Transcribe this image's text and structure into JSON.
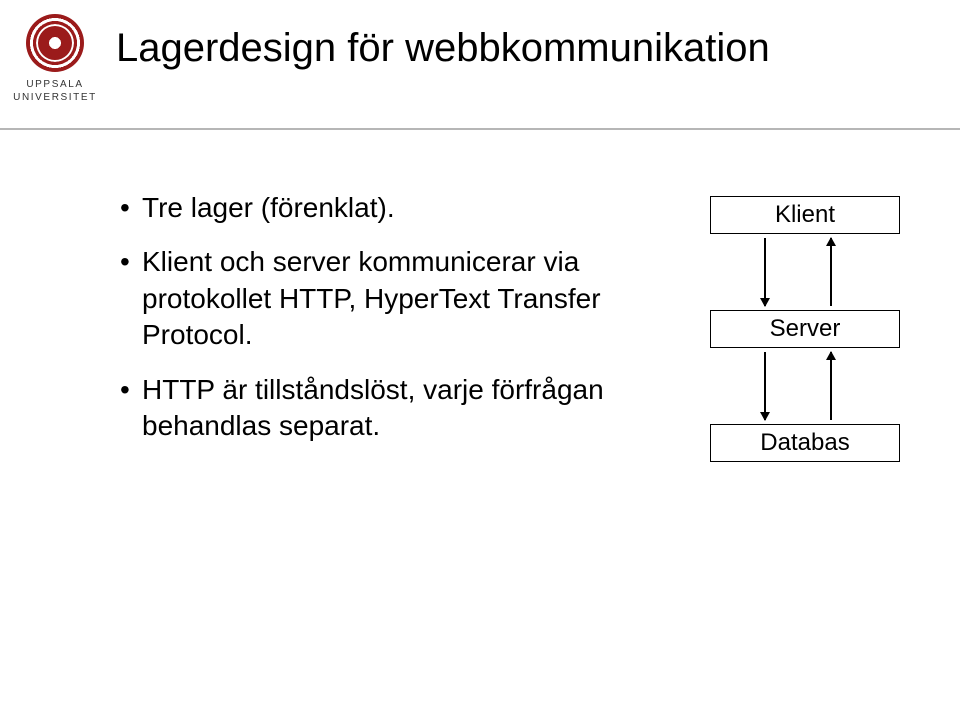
{
  "header": {
    "logo_line1": "UPPSALA",
    "logo_line2": "UNIVERSITET",
    "title": "Lagerdesign för webbkommunikation"
  },
  "bullets": [
    "Tre lager (förenklat).",
    "Klient och server kommunicerar via protokollet HTTP, HyperText Transfer Protocol.",
    "HTTP är tillståndslöst, varje förfrågan behandlas separat."
  ],
  "diagram": {
    "box1": "Klient",
    "box2": "Server",
    "box3": "Databas"
  },
  "chart_data": {
    "type": "diagram",
    "nodes": [
      "Klient",
      "Server",
      "Databas"
    ],
    "edges": [
      {
        "from": "Klient",
        "to": "Server",
        "direction": "bidirectional"
      },
      {
        "from": "Server",
        "to": "Databas",
        "direction": "bidirectional"
      }
    ],
    "title": "Lagerdesign för webbkommunikation"
  }
}
